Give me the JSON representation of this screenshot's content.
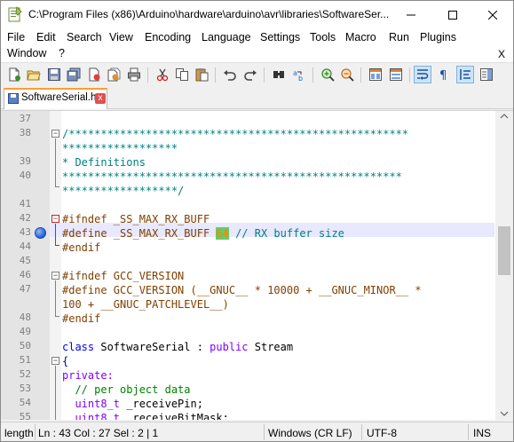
{
  "window": {
    "title": "C:\\Program Files (x86)\\Arduino\\hardware\\arduino\\avr\\libraries\\SoftwareSer...",
    "minimize_icon": "minimize-icon",
    "maximize_icon": "maximize-icon",
    "close_icon": "close-icon"
  },
  "menu": {
    "items": [
      "File",
      "Edit",
      "Search",
      "View",
      "Encoding",
      "Language",
      "Settings",
      "Tools",
      "Macro",
      "Run",
      "Plugins",
      "Window",
      "?"
    ],
    "close_label": "X"
  },
  "toolbar": {
    "buttons": [
      "new-file-icon",
      "open-file-icon",
      "save-icon",
      "save-all-icon",
      "close-icon",
      "close-all-icon",
      "print-icon",
      "cut-icon",
      "copy-icon",
      "paste-icon",
      "undo-icon",
      "redo-icon",
      "find-icon",
      "replace-icon",
      "zoom-in-icon",
      "zoom-out-icon",
      "sync-vertical-icon",
      "sync-horizontal-icon",
      "word-wrap-icon",
      "show-all-chars-icon",
      "indent-guide-icon",
      "document-map-icon"
    ]
  },
  "tab": {
    "label": "SoftwareSerial.h",
    "close_label": "x"
  },
  "editor": {
    "line_numbers": [
      "37",
      "38",
      "",
      "39",
      "40",
      "",
      "41",
      "42",
      "43",
      "44",
      "45",
      "46",
      "47",
      "",
      "48",
      "49",
      "50",
      "51",
      "52",
      "53",
      "54",
      "55"
    ],
    "lines": {
      "l38a": "/*****************************************************",
      "l38b": "******************",
      "l39": "* Definitions",
      "l40a": "*****************************************************",
      "l40b": "******************/",
      "l42_kw": "#ifndef",
      "l42_rest": " _SS_MAX_RX_BUFF",
      "l43_kw": "#define",
      "l43_name": " _SS_MAX_RX_BUFF ",
      "l43_num": "64",
      "l43_cmt": " // RX buffer size",
      "l44": "#endif",
      "l46_kw": "#ifndef",
      "l46_rest": " GCC_VERSION",
      "l47_kw": "#define",
      "l47_rest": " GCC_VERSION (__GNUC__ * 10000 + __GNUC_MINOR__ *",
      "l47b": "100 + __GNUC_PATCHLEVEL__)",
      "l48": "#endif",
      "l50_kw": "class",
      "l50_name": " SoftwareSerial : ",
      "l50_kw2": "public",
      "l50_rest": " Stream",
      "l51": "{",
      "l52": "private:",
      "l53": "  // per object data",
      "l54_type": "  uint8_t",
      "l54_rest": " _receivePin;",
      "l55_type": "  uint8_t",
      "l55_rest": " _receiveBitMask;"
    }
  },
  "statusbar": {
    "length": "length",
    "position": "Ln : 43    Col : 27    Sel : 2 | 1",
    "eol": "Windows (CR LF)",
    "encoding": "UTF-8",
    "mode": "INS"
  },
  "colors": {
    "tab_accent": "#f9a032",
    "comment": "#008080",
    "preprocessor": "#804000",
    "keyword": "#0000ff",
    "current_line": "#e8e8ff"
  }
}
